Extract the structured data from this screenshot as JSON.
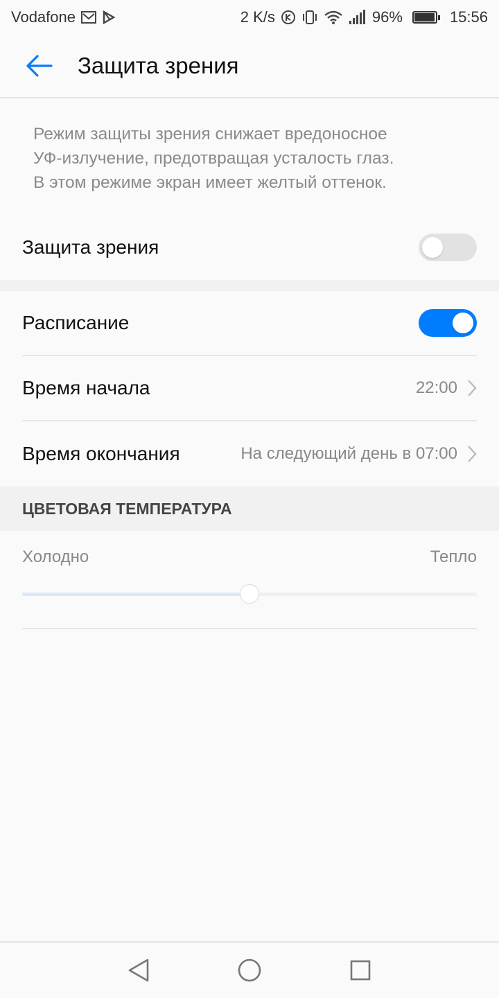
{
  "status_bar": {
    "carrier": "Vodafone",
    "speed": "2 K/s",
    "battery": "96%",
    "battery_level": 0.96,
    "time": "15:56"
  },
  "header": {
    "title": "Защита зрения"
  },
  "description": {
    "lines": [
      "Режим защиты зрения снижает вредоносное",
      "УФ-излучение, предотвращая усталость глаз.",
      "В этом режиме экран имеет желтый оттенок."
    ]
  },
  "eye_protection": {
    "label": "Защита зрения",
    "enabled": false
  },
  "schedule": {
    "label": "Расписание",
    "enabled": true,
    "start": {
      "label": "Время начала",
      "value": "22:00"
    },
    "end": {
      "label": "Время окончания",
      "value": "На следующий день в 07:00"
    }
  },
  "color_temperature": {
    "header": "ЦВЕТОВАЯ ТЕМПЕРАТУРА",
    "cold_label": "Холодно",
    "warm_label": "Тепло",
    "level": 0.5
  },
  "colors": {
    "accent": "#007dff",
    "background": "#fafafa"
  }
}
